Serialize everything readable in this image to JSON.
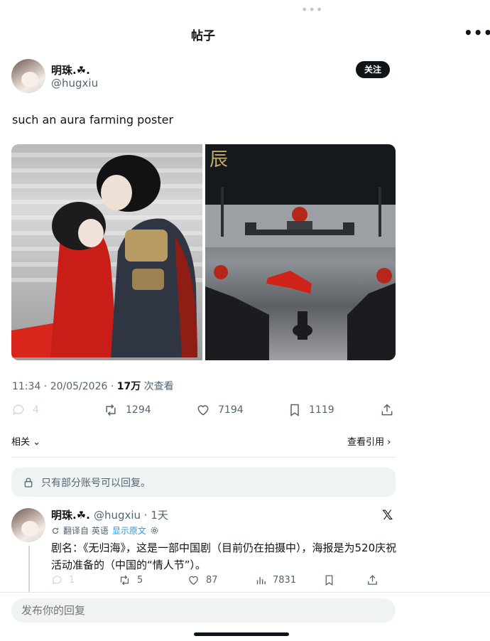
{
  "status": {
    "top_dots": "•••"
  },
  "header": {
    "title": "帖子",
    "more": "•••"
  },
  "post": {
    "author_name": "明珠.☘︎.",
    "author_handle": "@hugxiu",
    "follow_label": "关注",
    "text": "such an aura farming poster",
    "images": [
      {
        "poster_text": ""
      },
      {
        "poster_text": "辰"
      }
    ],
    "meta": {
      "time_date": "11:34 · 20/05/2026 · ",
      "views_count": "17万",
      "views_label": " 次查看"
    },
    "actions": {
      "replies": "4",
      "retweets": "1294",
      "likes": "7194",
      "bookmarks": "1119"
    },
    "related_label": "相关",
    "quotes_label": "查看引用"
  },
  "reply_notice": "只有部分账号可以回复。",
  "reply": {
    "author_name": "明珠.☘︎.",
    "handle_time": "@hugxiu · 1天",
    "translated_from": "翻译自 英语",
    "show_original": "显示原文",
    "text": "剧名：《无归海》，这是一部中国剧（目前仍在拍摄中），海报是为520庆祝活动准备的（中国的“情人节”）。",
    "actions": {
      "replies": "1",
      "retweets": "5",
      "likes": "87",
      "views": "7831"
    }
  },
  "compose_placeholder": "发布你的回复",
  "icons": [
    "reply-icon",
    "retweet-icon",
    "like-icon",
    "bookmark-icon",
    "share-icon",
    "lock-icon",
    "x-logo-icon",
    "views-icon",
    "translate-icon",
    "gear-icon",
    "chevron-down-icon",
    "chevron-right-icon"
  ],
  "colors": {
    "text": "#0f1419",
    "muted": "#536471",
    "link": "#1d9bf0",
    "surface": "#eff3f4"
  }
}
